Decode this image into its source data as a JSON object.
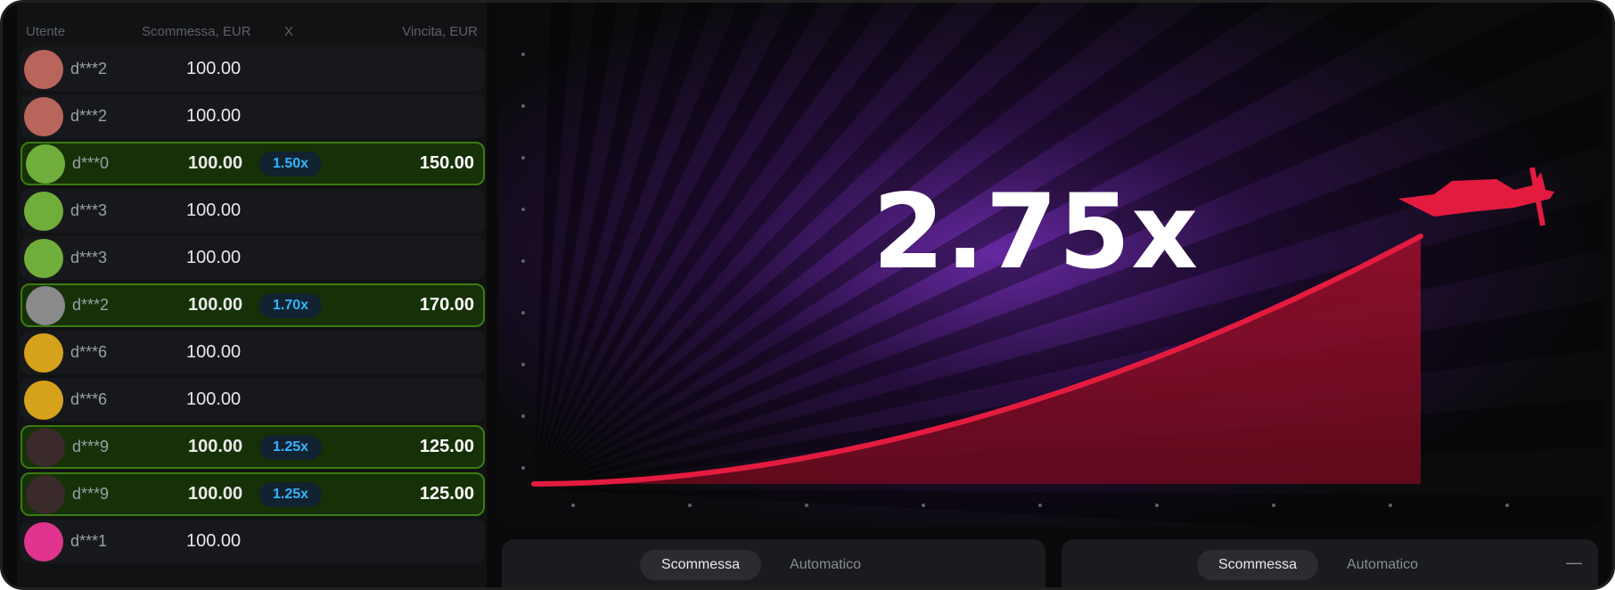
{
  "list": {
    "headers": {
      "user": "Utente",
      "bet": "Scommessa, EUR",
      "x": "X",
      "win": "Vincita, EUR"
    },
    "rows": [
      {
        "user": "d***2",
        "bet": "100.00",
        "mult": "",
        "win": "",
        "won": false,
        "avatar_color": "#b8655b"
      },
      {
        "user": "d***2",
        "bet": "100.00",
        "mult": "",
        "win": "",
        "won": false,
        "avatar_color": "#b8655b"
      },
      {
        "user": "d***0",
        "bet": "100.00",
        "mult": "1.50x",
        "win": "150.00",
        "won": true,
        "avatar_color": "#6fae3a"
      },
      {
        "user": "d***3",
        "bet": "100.00",
        "mult": "",
        "win": "",
        "won": false,
        "avatar_color": "#6fae3a"
      },
      {
        "user": "d***3",
        "bet": "100.00",
        "mult": "",
        "win": "",
        "won": false,
        "avatar_color": "#6fae3a"
      },
      {
        "user": "d***2",
        "bet": "100.00",
        "mult": "1.70x",
        "win": "170.00",
        "won": true,
        "avatar_color": "#8a8a8a"
      },
      {
        "user": "d***6",
        "bet": "100.00",
        "mult": "",
        "win": "",
        "won": false,
        "avatar_color": "#d7a21b"
      },
      {
        "user": "d***6",
        "bet": "100.00",
        "mult": "",
        "win": "",
        "won": false,
        "avatar_color": "#d7a21b"
      },
      {
        "user": "d***9",
        "bet": "100.00",
        "mult": "1.25x",
        "win": "125.00",
        "won": true,
        "avatar_color": "#3a2a2a"
      },
      {
        "user": "d***9",
        "bet": "100.00",
        "mult": "1.25x",
        "win": "125.00",
        "won": true,
        "avatar_color": "#3a2a2a"
      },
      {
        "user": "d***1",
        "bet": "100.00",
        "mult": "",
        "win": "",
        "won": false,
        "avatar_color": "#e0348e"
      }
    ]
  },
  "game": {
    "multiplier": "2.75x",
    "curve_color": "#e31b3f",
    "background_glow": "#5a1a8c"
  },
  "panels": [
    {
      "tabs": [
        "Scommessa",
        "Automatico"
      ],
      "active": 0
    },
    {
      "tabs": [
        "Scommessa",
        "Automatico"
      ],
      "active": 0
    }
  ],
  "icons": {
    "options": "dash-icon"
  }
}
